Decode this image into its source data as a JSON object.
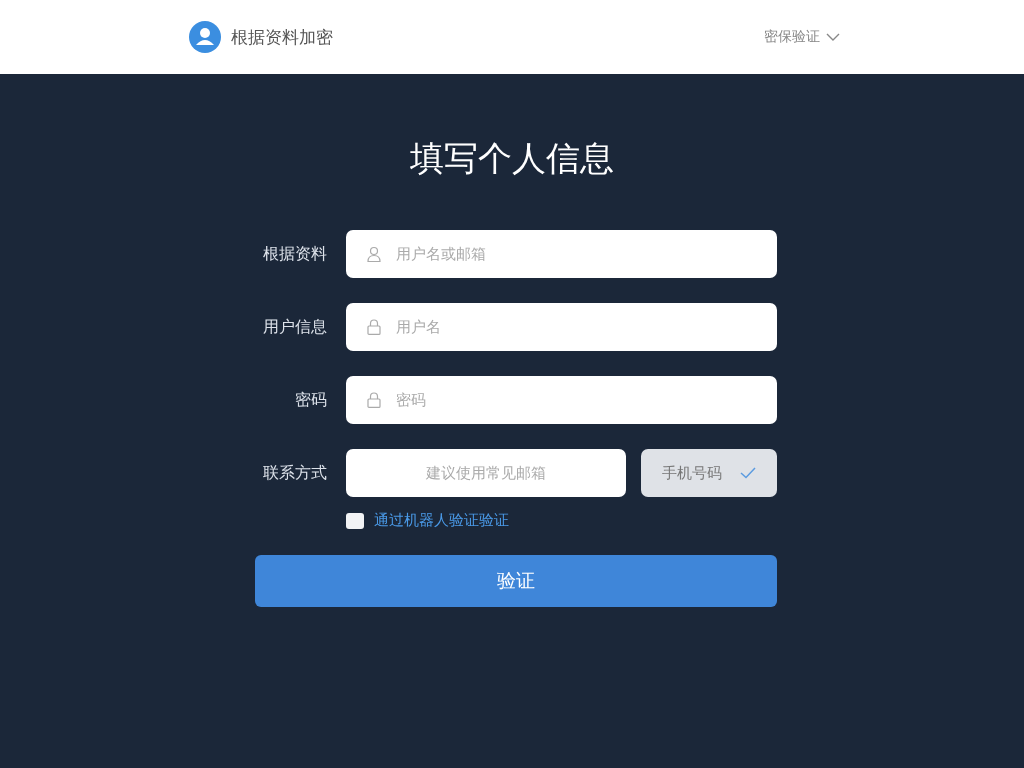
{
  "header": {
    "brand": "根据资料加密",
    "menu": "密保验证"
  },
  "title": "填写个人信息",
  "fields": [
    {
      "label": "根据资料",
      "placeholder": "用户名或邮箱",
      "kind": "account"
    },
    {
      "label": "用户信息",
      "placeholder": "用户名",
      "kind": "username"
    },
    {
      "label": "密码",
      "placeholder": "密码",
      "kind": "password"
    }
  ],
  "contact": {
    "label": "联系方式",
    "placeholder": "建议使用常见邮箱",
    "option": "手机号码",
    "option_selected": true
  },
  "captcha": {
    "label": "通过机器人验证验证",
    "checked": false
  },
  "submit": "验证"
}
